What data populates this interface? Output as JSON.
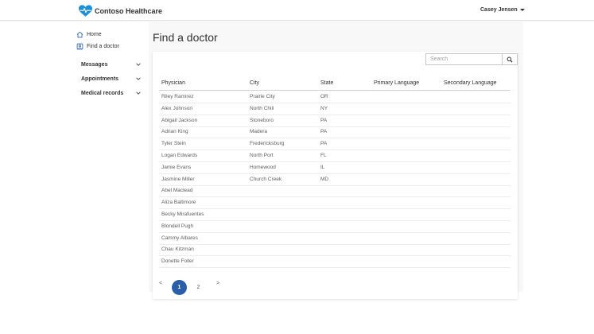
{
  "header": {
    "brand": "Contoso Healthcare",
    "user_name": "Casey Jensen",
    "accent_color": "#2a5ea8",
    "logo_color": "#1e90d8"
  },
  "sidebar": {
    "links": [
      {
        "label": "Home",
        "icon": "home-icon"
      },
      {
        "label": "Find a doctor",
        "icon": "doctor-icon"
      }
    ],
    "groups": [
      {
        "label": "Messages",
        "icon": "chevron-down-icon"
      },
      {
        "label": "Appointments",
        "icon": "chevron-down-icon"
      },
      {
        "label": "Medical records",
        "icon": "chevron-down-icon"
      }
    ]
  },
  "main": {
    "title": "Find a doctor",
    "search": {
      "placeholder": "Search",
      "value": "",
      "icon": "search-icon"
    },
    "table": {
      "columns": [
        "Physician",
        "City",
        "State",
        "Primary Language",
        "Secondary Language"
      ],
      "rows": [
        [
          "Riley Ramirez",
          "Prairie City",
          "OR",
          "",
          ""
        ],
        [
          "Alex Johnson",
          "North Chili",
          "NY",
          "",
          ""
        ],
        [
          "Abigail Jackson",
          "Stoneboro",
          "PA",
          "",
          ""
        ],
        [
          "Adrian King",
          "Madera",
          "PA",
          "",
          ""
        ],
        [
          "Tyler Stein",
          "Fredericksburg",
          "PA",
          "",
          ""
        ],
        [
          "Logan Edwards",
          "North Port",
          "FL",
          "",
          ""
        ],
        [
          "Jamie Evans",
          "Homewood",
          "IL",
          "",
          ""
        ],
        [
          "Jasmine Miller",
          "Church Creek",
          "MD",
          "",
          ""
        ],
        [
          "Abel Maclead",
          "",
          "",
          "",
          ""
        ],
        [
          "Aliza Baltimore",
          "",
          "",
          "",
          ""
        ],
        [
          "Becky Mirafuentes",
          "",
          "",
          "",
          ""
        ],
        [
          "Blondell Pugh",
          "",
          "",
          "",
          ""
        ],
        [
          "Cammy Albares",
          "",
          "",
          "",
          ""
        ],
        [
          "Chau Kitzman",
          "",
          "",
          "",
          ""
        ],
        [
          "Donette Foller",
          "",
          "",
          "",
          ""
        ]
      ]
    },
    "pagination": {
      "prev": "<",
      "next": ">",
      "pages": [
        "1",
        "2"
      ],
      "current": "1"
    }
  }
}
